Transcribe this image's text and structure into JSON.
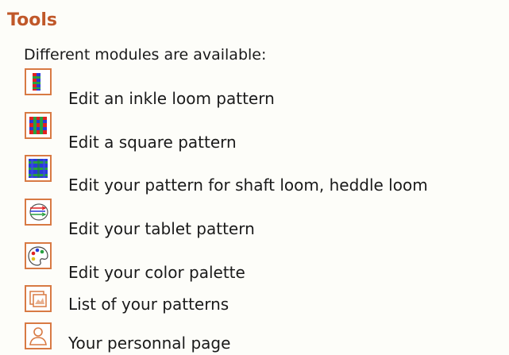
{
  "section": {
    "title": "Tools",
    "intro": "Different modules are available:"
  },
  "tools": [
    {
      "label": "Edit an inkle loom pattern",
      "icon": "inkle-loom-icon"
    },
    {
      "label": "Edit a square pattern",
      "icon": "square-pattern-icon"
    },
    {
      "label": "Edit your pattern for shaft loom, heddle loom",
      "icon": "shaft-loom-icon"
    },
    {
      "label": "Edit your tablet pattern",
      "icon": "tablet-pattern-icon"
    },
    {
      "label": "Edit your color palette",
      "icon": "color-palette-icon"
    },
    {
      "label": "List of your patterns",
      "icon": "pattern-list-icon"
    },
    {
      "label": "Your personnal page",
      "icon": "person-icon"
    }
  ],
  "colors": {
    "title": "#c0582a",
    "icon_border": "#d87a44"
  }
}
